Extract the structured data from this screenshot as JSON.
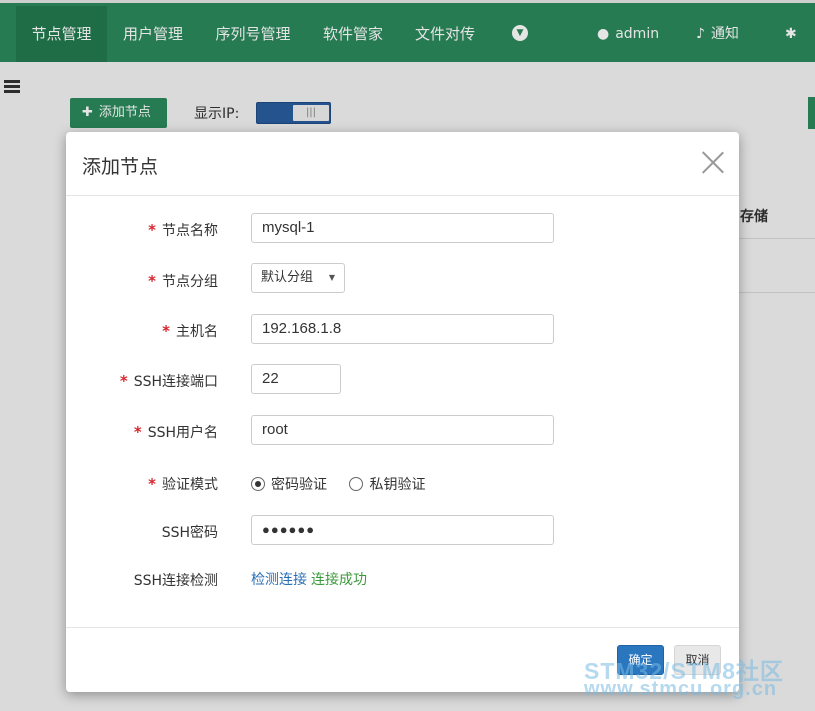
{
  "nav": {
    "items": [
      {
        "label": "节点管理",
        "active": true
      },
      {
        "label": "用户管理"
      },
      {
        "label": "序列号管理"
      },
      {
        "label": "软件管家"
      },
      {
        "label": "文件对传"
      }
    ],
    "more_icon": "chevron-down-circle-icon",
    "user_label": "admin",
    "notify_label": "通知",
    "settings_label": "设",
    "bg_color": "#2b8a5c"
  },
  "page": {
    "add_node_label": "添加节点",
    "show_ip_label": "显示IP:",
    "column_header": "存储"
  },
  "modal": {
    "title": "添加节点",
    "fields": {
      "node_name": {
        "label": "节点名称",
        "value": "mysql-1",
        "required": true
      },
      "node_group": {
        "label": "节点分组",
        "value": "默认分组",
        "required": true
      },
      "hostname": {
        "label": "主机名",
        "value": "192.168.1.8",
        "required": true
      },
      "ssh_port": {
        "label": "SSH连接端口",
        "value": "22",
        "required": true
      },
      "ssh_user": {
        "label": "SSH用户名",
        "value": "root",
        "required": true
      },
      "auth_mode": {
        "label": "验证模式",
        "required": true,
        "options": [
          "密码验证",
          "私钥验证"
        ],
        "selected": "密码验证"
      },
      "ssh_password": {
        "label": "SSH密码",
        "value": "●●●●●●"
      },
      "ssh_check": {
        "label": "SSH连接检测",
        "link": "检测连接",
        "status": "连接成功"
      }
    },
    "required_mark": "*",
    "ok_label": "确定",
    "cancel_label": "取消"
  },
  "watermark": {
    "line1": "STM32/STM8社区",
    "line2": "www.stmcu.org.cn"
  }
}
